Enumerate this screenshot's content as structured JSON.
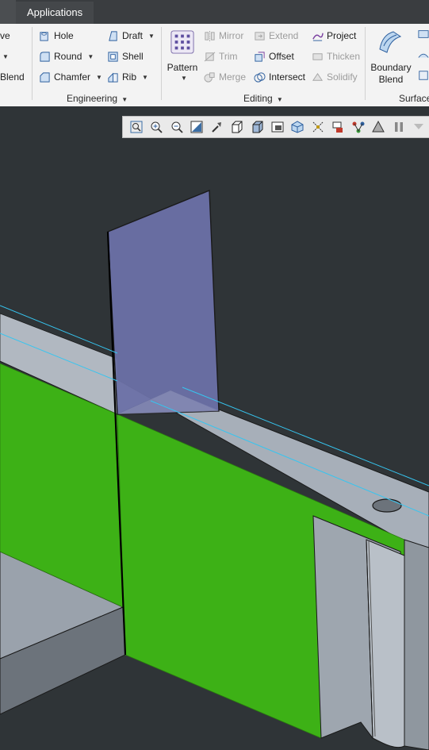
{
  "topbar": {
    "tab_label": "Applications"
  },
  "ribbon": {
    "partial_left": {
      "item1": "ve",
      "item3": "Blend"
    },
    "engineering": {
      "label": "Engineering",
      "hole": "Hole",
      "round": "Round",
      "chamfer": "Chamfer",
      "draft": "Draft",
      "shell": "Shell",
      "rib": "Rib"
    },
    "editing": {
      "label": "Editing",
      "pattern": "Pattern",
      "mirror": "Mirror",
      "trim": "Trim",
      "merge": "Merge",
      "extend": "Extend",
      "offset": "Offset",
      "intersect": "Intersect",
      "project": "Project",
      "thicken": "Thicken",
      "solidify": "Solidify"
    },
    "surfaces": {
      "label": "Surface",
      "boundary_blend_line1": "Boundary",
      "boundary_blend_line2": "Blend"
    }
  },
  "colors": {
    "viewport_bg": "#2f3437",
    "surface_green": "#3db116",
    "datum_plane": "#6b71a6",
    "model_gray": "#9aa2ac",
    "edge_cyan": "#36c5f0"
  },
  "view_toolbar": {
    "icons": [
      "refit-icon",
      "zoom-in-icon",
      "zoom-out-icon",
      "repaint-icon",
      "reorient-icon",
      "saved-orientations-icon",
      "display-style-icon",
      "view-manager-icon",
      "perspective-icon",
      "datum-display-icon",
      "annotation-display-icon",
      "spin-center-icon",
      "appearance-icon",
      "pause-icon",
      "more-icon"
    ]
  }
}
